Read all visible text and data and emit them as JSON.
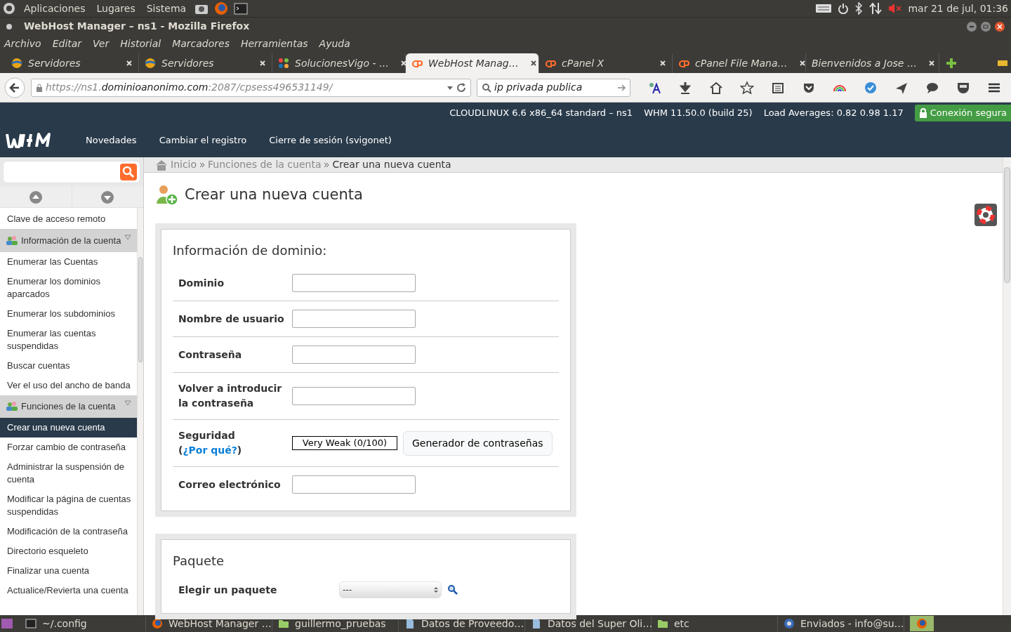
{
  "top_panel": {
    "menus": [
      "Aplicaciones",
      "Lugares",
      "Sistema"
    ],
    "clock": "mar 21 de jul, 01:36"
  },
  "window": {
    "title": "WebHost Manager – ns1 - Mozilla Firefox"
  },
  "menubar": [
    "Archivo",
    "Editar",
    "Ver",
    "Historial",
    "Marcadores",
    "Herramientas",
    "Ayuda"
  ],
  "tabs": [
    {
      "label": "Servidores",
      "kind": "globe",
      "selected": false
    },
    {
      "label": "Servidores",
      "kind": "globe",
      "selected": false
    },
    {
      "label": "SolucionesVigo - …",
      "kind": "joomla",
      "selected": false
    },
    {
      "label": "WebHost Manag…",
      "kind": "cpanel",
      "selected": true
    },
    {
      "label": "cPanel X",
      "kind": "cpanel",
      "selected": false
    },
    {
      "label": "cPanel File Mana…",
      "kind": "cpanel",
      "selected": false
    },
    {
      "label": "Bienvenidos a Jose …",
      "kind": "none",
      "selected": false
    }
  ],
  "address_bar": {
    "url_prefix": "https://ns1.",
    "url_domain": "dominioanonimo.com",
    "url_suffix": ":2087/cpsess496531149/"
  },
  "search_bar": {
    "value": "ip privada publica"
  },
  "whm_header": {
    "server_info": [
      "CLOUDLINUX 6.6 x86_64 standard – ns1",
      "WHM 11.50.0 (build 25)",
      "Load Averages: 0.82 0.98 1.17"
    ],
    "secure_badge": "Conexión segura",
    "nav": [
      "Novedades",
      "Cambiar el registro",
      "Cierre de sesión (svigonet)"
    ]
  },
  "breadcrumb": [
    "Inicio",
    "Funciones de la cuenta",
    "Crear una nueva cuenta"
  ],
  "sidebar": {
    "items": [
      {
        "label": "Clave de acceso remoto",
        "kind": "item",
        "selected": false
      },
      {
        "label": "Información de la cuenta",
        "kind": "group",
        "selected": false
      },
      {
        "label": "Enumerar las Cuentas",
        "kind": "item",
        "selected": false
      },
      {
        "label": "Enumerar los dominios aparcados",
        "kind": "item",
        "selected": false
      },
      {
        "label": "Enumerar los subdominios",
        "kind": "item",
        "selected": false
      },
      {
        "label": "Enumerar las cuentas suspendidas",
        "kind": "item",
        "selected": false
      },
      {
        "label": "Buscar cuentas",
        "kind": "item",
        "selected": false
      },
      {
        "label": "Ver el uso del ancho de banda",
        "kind": "item",
        "selected": false
      },
      {
        "label": "Funciones de la cuenta",
        "kind": "group",
        "selected": false
      },
      {
        "label": "Crear una nueva cuenta",
        "kind": "item",
        "selected": true
      },
      {
        "label": "Forzar cambio de contraseña",
        "kind": "item",
        "selected": false
      },
      {
        "label": "Administrar la suspensión de cuenta",
        "kind": "item",
        "selected": false
      },
      {
        "label": "Modificar la página de cuentas suspendidas",
        "kind": "item",
        "selected": false
      },
      {
        "label": "Modificación de la contraseña",
        "kind": "item",
        "selected": false
      },
      {
        "label": "Directorio esqueleto",
        "kind": "item",
        "selected": false
      },
      {
        "label": "Finalizar una cuenta",
        "kind": "item",
        "selected": false
      },
      {
        "label": "Actualice/Revierta una cuenta",
        "kind": "item",
        "selected": false
      }
    ]
  },
  "page": {
    "title": "Crear una nueva cuenta",
    "domain_section": {
      "heading": "Información de dominio:",
      "fields": [
        {
          "label": "Dominio",
          "kind": "text"
        },
        {
          "label": "Nombre de usuario",
          "kind": "text"
        },
        {
          "label": "Contraseña",
          "kind": "text"
        },
        {
          "label": "Volver a introducir la contraseña",
          "kind": "text"
        },
        {
          "label": "Seguridad (",
          "link": "¿Por qué?",
          "label_end": ")",
          "kind": "strength",
          "meter": "Very Weak (0/100)",
          "level": 0,
          "button": "Generador de contraseñas"
        },
        {
          "label": "Correo electrónico",
          "kind": "text"
        }
      ]
    },
    "package_section": {
      "heading": "Paquete",
      "label": "Elegir un paquete",
      "value": "---"
    }
  },
  "taskbar": [
    {
      "label": "~/.config",
      "kind": "terminal"
    },
    {
      "label": "WebHost Manager …",
      "kind": "firefox"
    },
    {
      "label": "guillermo_pruebas",
      "kind": "folder"
    },
    {
      "label": "Datos de Proveedo…",
      "kind": "doc"
    },
    {
      "label": "Datos del Super Oli…",
      "kind": "doc"
    },
    {
      "label": "etc",
      "kind": "folder"
    },
    {
      "label": "Enviados - info@su…",
      "kind": "mail"
    }
  ]
}
